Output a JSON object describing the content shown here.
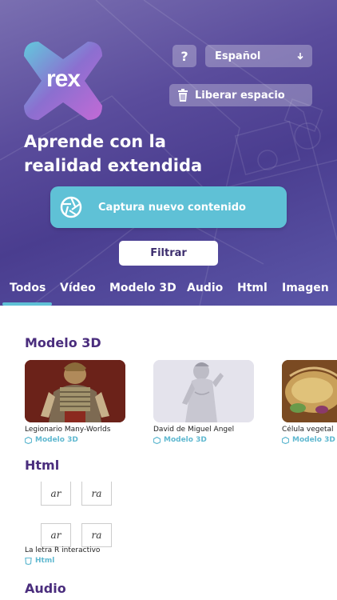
{
  "app": {
    "logo_text": "rex"
  },
  "header": {
    "help_label": "?",
    "language": "Español",
    "free_space_label": "Liberar espacio",
    "title_line1": "Aprende con la",
    "title_line2": "realidad extendida",
    "capture_label": "Captura nuevo contenido",
    "filter_label": "Filtrar"
  },
  "tabs": [
    "Todos",
    "Vídeo",
    "Modelo 3D",
    "Audio",
    "Html",
    "Imagen"
  ],
  "active_tab": "Todos",
  "sections": {
    "model3d": {
      "title": "Modelo 3D",
      "items": [
        {
          "title": "Legionario Many-Worlds",
          "type": "Modelo 3D"
        },
        {
          "title": "David de Miguel Ángel",
          "type": "Modelo 3D"
        },
        {
          "title": "Célula vegetal",
          "type": "Modelo 3D"
        }
      ]
    },
    "html": {
      "title": "Html",
      "items": [
        {
          "title": "La letra R interactivo",
          "type": "Html",
          "tiles": [
            "ar",
            "ra",
            "ar",
            "ra"
          ]
        }
      ]
    },
    "audio": {
      "title": "Audio"
    }
  },
  "colors": {
    "accent": "#5fc1d6",
    "section_title": "#4a2d7d",
    "header_bg": "#4a3d8f"
  }
}
